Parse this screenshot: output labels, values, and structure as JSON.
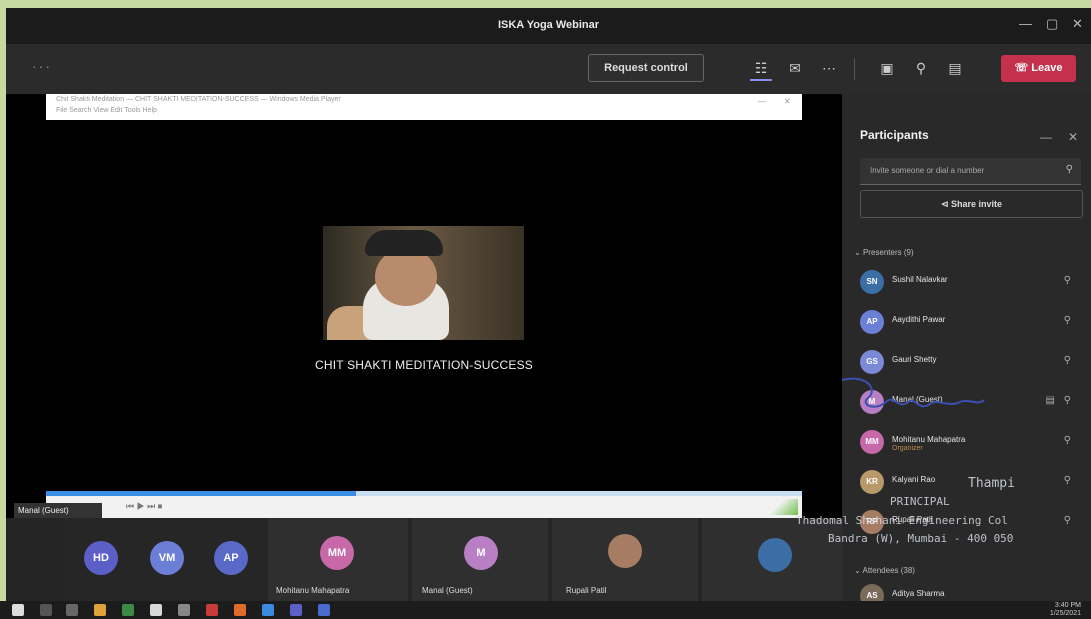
{
  "window": {
    "title": "ISKA Yoga Webinar",
    "controls": [
      "—",
      "▢",
      "✕"
    ]
  },
  "toolbar": {
    "more_label": "···",
    "request_control": "Request control",
    "leave_label": "Leave"
  },
  "shared_window": {
    "title_text": "Chit Shakti Meditation — CHIT SHAKTI MEDITATION-SUCCESS — Windows Media Player",
    "menu_text": "File   Search   View   Edit   Tools   Help",
    "close": "✕",
    "minimize": "—"
  },
  "video": {
    "caption": "CHIT SHAKTI MEDITATION-SUCCESS",
    "progress_fraction": 0.41,
    "player_controls": "⏮  ▶  ⏭    ⏹",
    "presenter_label": "Manal (Guest)"
  },
  "gallery": {
    "tiles": [
      {
        "initials": "HD",
        "color": "#5b5fc7"
      },
      {
        "initials": "VM",
        "color": "#6b7fd6"
      },
      {
        "initials": "AP",
        "color": "#5a68c8"
      },
      {
        "initials": "MM",
        "color": "#c768a8",
        "name": "Mohitanu Mahapatra"
      },
      {
        "initials": "M",
        "color": "#b87fc5",
        "name": "Manal (Guest)"
      },
      {
        "initials": "",
        "color": "#a67c62",
        "name": "Rupali Patil"
      },
      {
        "initials": "",
        "color": "#3a6ea5",
        "name": ""
      }
    ]
  },
  "participants": {
    "heading": "Participants",
    "search_placeholder": "Invite someone or dial a number",
    "share_invite": "Share invite",
    "presenters_label": "Presenters (9)",
    "attendees_label": "Attendees (38)",
    "people": [
      {
        "name": "Sushil Nalavkar",
        "avatar": "SN",
        "color": "#3a6ea5",
        "sub": ""
      },
      {
        "name": "Aaydithi Pawar",
        "avatar": "AP",
        "color": "#6b7fd6",
        "sub": ""
      },
      {
        "name": "Gauri Shetty",
        "avatar": "GS",
        "color": "#7a8ad6",
        "sub": ""
      },
      {
        "name": "Manal (Guest)",
        "avatar": "M",
        "color": "#b87fc5",
        "sub": ""
      },
      {
        "name": "Mohitanu Mahapatra",
        "avatar": "MM",
        "color": "#c768a8",
        "sub": "Organizer"
      },
      {
        "name": "Kalyani Rao",
        "avatar": "KR",
        "color": "#b89a6a",
        "sub": ""
      },
      {
        "name": "Rupali Patil",
        "avatar": "RP",
        "color": "#a67c62",
        "sub": ""
      },
      {
        "name": "Aditya Sharma",
        "avatar": "AS",
        "color": "#7a6a5a",
        "sub": ""
      }
    ]
  },
  "stamp": {
    "line1": "Thampi",
    "line2": "PRINCIPAL",
    "line3": "Thadomal Shahani Engineering Col",
    "line4": "Bandra (W), Mumbai - 400 050"
  },
  "taskbar": {
    "time": "3:40 PM",
    "date": "1/25/2021"
  }
}
